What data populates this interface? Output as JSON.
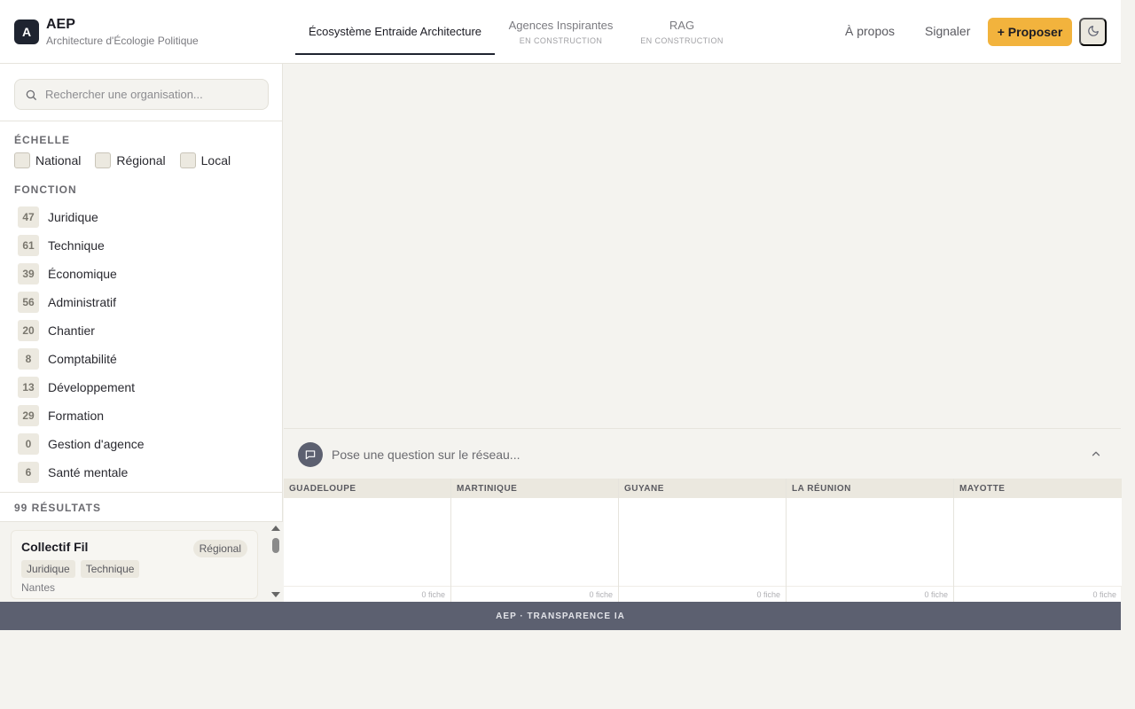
{
  "brand": {
    "logo_letter": "A",
    "title": "AEP",
    "subtitle": "Architecture d'Écologie Politique"
  },
  "tabs": [
    {
      "label": "Écosystème Entraide Architecture",
      "sub": "",
      "active": true
    },
    {
      "label": "Agences Inspirantes",
      "sub": "EN CONSTRUCTION",
      "active": false
    },
    {
      "label": "RAG",
      "sub": "EN CONSTRUCTION",
      "active": false
    }
  ],
  "nav": {
    "about": "À propos",
    "report": "Signaler",
    "propose": "+ Proposer",
    "theme_icon": "moon-icon"
  },
  "search": {
    "placeholder": "Rechercher une organisation..."
  },
  "filters": {
    "scale_title": "ÉCHELLE",
    "scales": [
      "National",
      "Régional",
      "Local"
    ],
    "function_title": "FONCTION",
    "functions": [
      {
        "count": "47",
        "label": "Juridique"
      },
      {
        "count": "61",
        "label": "Technique"
      },
      {
        "count": "39",
        "label": "Économique"
      },
      {
        "count": "56",
        "label": "Administratif"
      },
      {
        "count": "20",
        "label": "Chantier"
      },
      {
        "count": "8",
        "label": "Comptabilité"
      },
      {
        "count": "13",
        "label": "Développement"
      },
      {
        "count": "29",
        "label": "Formation"
      },
      {
        "count": "0",
        "label": "Gestion d'agence"
      },
      {
        "count": "6",
        "label": "Santé mentale"
      }
    ]
  },
  "results": {
    "count_label": "99 RÉSULTATS",
    "cards": [
      {
        "title": "Collectif Fil",
        "badge": "Régional",
        "tags": [
          "Juridique",
          "Technique"
        ],
        "city": "Nantes"
      }
    ]
  },
  "question": {
    "placeholder": "Pose une question sur le réseau..."
  },
  "territories": [
    {
      "name": "GUADELOUPE",
      "count": "0 fiche"
    },
    {
      "name": "MARTINIQUE",
      "count": "0 fiche"
    },
    {
      "name": "GUYANE",
      "count": "0 fiche"
    },
    {
      "name": "LA RÉUNION",
      "count": "0 fiche"
    },
    {
      "name": "MAYOTTE",
      "count": "0 fiche"
    }
  ],
  "footer": {
    "text": "AEP · TRANSPARENCE IA"
  }
}
